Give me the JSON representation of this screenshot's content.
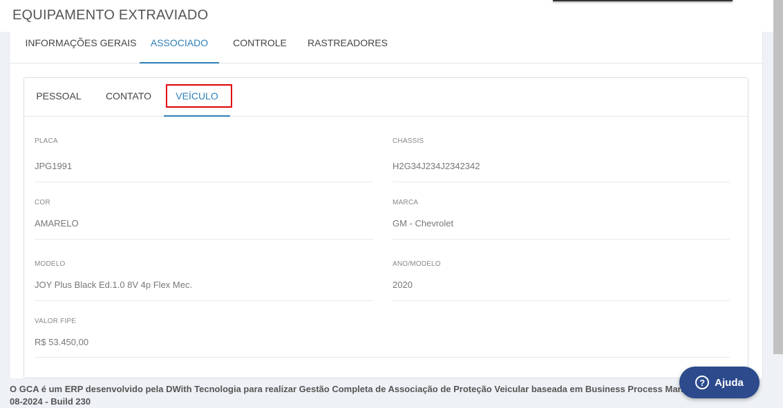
{
  "page": {
    "title": "EQUIPAMENTO EXTRAVIADO"
  },
  "main_tabs": [
    {
      "label": "INFORMAÇÕES GERAIS",
      "active": false
    },
    {
      "label": "ASSOCIADO",
      "active": true
    },
    {
      "label": "CONTROLE",
      "active": false
    },
    {
      "label": "RASTREADORES",
      "active": false
    }
  ],
  "sub_tabs": [
    {
      "label": "PESSOAL",
      "active": false
    },
    {
      "label": "CONTATO",
      "active": false
    },
    {
      "label": "VEÍCULO",
      "active": true
    }
  ],
  "fields": {
    "placa": {
      "label": "PLACA",
      "value": "JPG1991"
    },
    "chassis": {
      "label": "CHASSIS",
      "value": "H2G34J234J2342342"
    },
    "cor": {
      "label": "COR",
      "value": "AMARELO"
    },
    "marca": {
      "label": "MARCA",
      "value": "GM - Chevrolet"
    },
    "modelo": {
      "label": "MODELO",
      "value": "JOY Plus Black Ed.1.0 8V 4p Flex Mec."
    },
    "ano_modelo": {
      "label": "ANO/MODELO",
      "value": "2020"
    },
    "valor_fipe": {
      "label": "VALOR FIPE",
      "value": "R$ 53.450,00"
    }
  },
  "footer": {
    "text_line1": "O GCA é um ERP desenvolvido pela DWith Tecnologia para realizar Gestão Completa de Associação de Proteção Veicular baseada em Business Process Managem",
    "text_line1_tail": "-",
    "text_line2": "08-2024 - Build 230"
  },
  "help": {
    "label": "Ajuda",
    "icon": "question-circle-icon"
  },
  "colors": {
    "accent": "#2e7fb8",
    "help_button": "#2c4a8c",
    "highlight": "#e00000"
  }
}
